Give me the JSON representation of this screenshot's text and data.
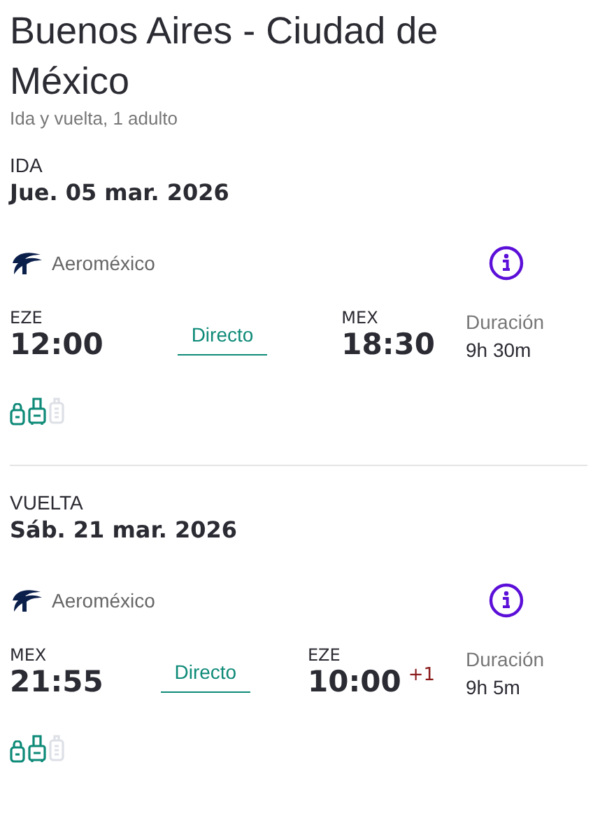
{
  "title": "Buenos Aires - Ciudad de México",
  "subtitle": "Ida y vuelta, 1 adulto",
  "legs": [
    {
      "label": "IDA",
      "date": "Jue. 05 mar. 2026",
      "airline": "Aeroméxico",
      "from_code": "EZE",
      "from_time": "12:00",
      "stops": "Directo",
      "to_code": "MEX",
      "to_time": "18:30",
      "duration_label": "Duración",
      "duration": "9h 30m",
      "bags": [
        {
          "kind": "personal",
          "included": true
        },
        {
          "kind": "carry",
          "included": true
        },
        {
          "kind": "checked",
          "included": false
        }
      ]
    },
    {
      "label": "VUELTA",
      "date": "Sáb. 21 mar. 2026",
      "airline": "Aeroméxico",
      "from_code": "MEX",
      "from_time": "21:55",
      "stops": "Directo",
      "to_code": "EZE",
      "to_time": "10:00",
      "day_offset": "+1",
      "duration_label": "Duración",
      "duration": "9h 5m",
      "bags": [
        {
          "kind": "personal",
          "included": true
        },
        {
          "kind": "carry",
          "included": true
        },
        {
          "kind": "checked",
          "included": false
        }
      ]
    }
  ]
}
